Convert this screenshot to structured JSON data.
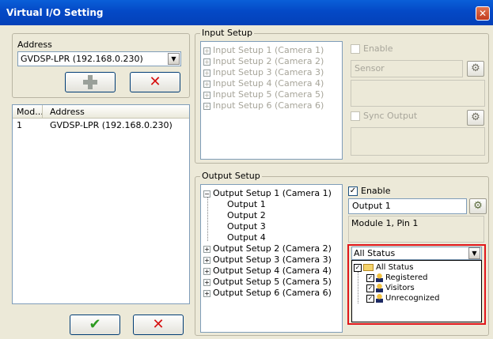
{
  "window": {
    "title": "Virtual I/O Setting",
    "close_glyph": "✕"
  },
  "left": {
    "address_label": "Address",
    "address_value": "GVDSP-LPR (192.168.0.230)",
    "add_icon": "plus-icon",
    "remove_icon": "x-icon",
    "list_headers": [
      "Mod...",
      "Address"
    ],
    "list_rows": [
      {
        "mod": "1",
        "address": "GVDSP-LPR (192.168.0.230)"
      }
    ],
    "ok_icon": "checkmark-icon",
    "cancel_icon": "x-icon"
  },
  "input_setup": {
    "legend": "Input Setup",
    "items": [
      "Input Setup 1 (Camera 1)",
      "Input Setup 2 (Camera 2)",
      "Input Setup 3 (Camera 3)",
      "Input Setup 4 (Camera 4)",
      "Input Setup 5 (Camera 5)",
      "Input Setup 6 (Camera 6)"
    ],
    "enable_label": "Enable",
    "sensor_value": "Sensor",
    "sync_output_label": "Sync Output"
  },
  "output_setup": {
    "legend": "Output Setup",
    "items": [
      "Output Setup 1 (Camera 1)",
      "Output 1",
      "Output 2",
      "Output 3",
      "Output 4",
      "Output Setup 2 (Camera 2)",
      "Output Setup 3 (Camera 3)",
      "Output Setup 4 (Camera 4)",
      "Output Setup 5 (Camera 5)",
      "Output Setup 6 (Camera 6)"
    ],
    "enable_label": "Enable",
    "output_name": "Output 1",
    "module_info": "Module 1, Pin 1",
    "status_select": "All Status",
    "status_tree": [
      "All Status",
      "Registered",
      "Visitors",
      "Unrecognized"
    ]
  },
  "colors": {
    "title_bar": "#0449c6",
    "highlight_box": "#e0161a"
  }
}
